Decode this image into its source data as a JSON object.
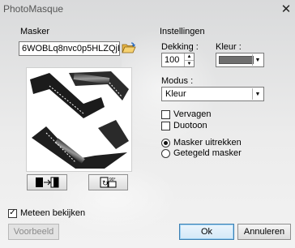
{
  "window": {
    "title": "PhotoMasque",
    "close_glyph": "✕"
  },
  "mask": {
    "section_label": "Masker",
    "filename": "6WOBLq8nvc0p5HLZQjBB-I",
    "browse_icon": "open-folder-icon"
  },
  "settings": {
    "section_label": "Instellingen",
    "opacity_label": "Dekking :",
    "opacity_value": "100",
    "color_label": "Kleur :",
    "color_value": "#6e6e6e",
    "mode_label": "Modus :",
    "mode_value": "Kleur",
    "fade_label": "Vervagen",
    "fade_checked": false,
    "duotone_label": "Duotoon",
    "duotone_checked": false,
    "stretch_label": "Masker uitrekken",
    "stretch_selected": true,
    "tile_label": "Getegeld masker",
    "tile_selected": false
  },
  "preview_toggle": {
    "label": "Meteen bekijken",
    "checked": true
  },
  "buttons": {
    "preview": "Voorbeeld",
    "ok": "Ok",
    "cancel": "Annuleren",
    "flip_icon": "flip-horizontal-icon",
    "rotate_icon": "rotate-icon"
  }
}
